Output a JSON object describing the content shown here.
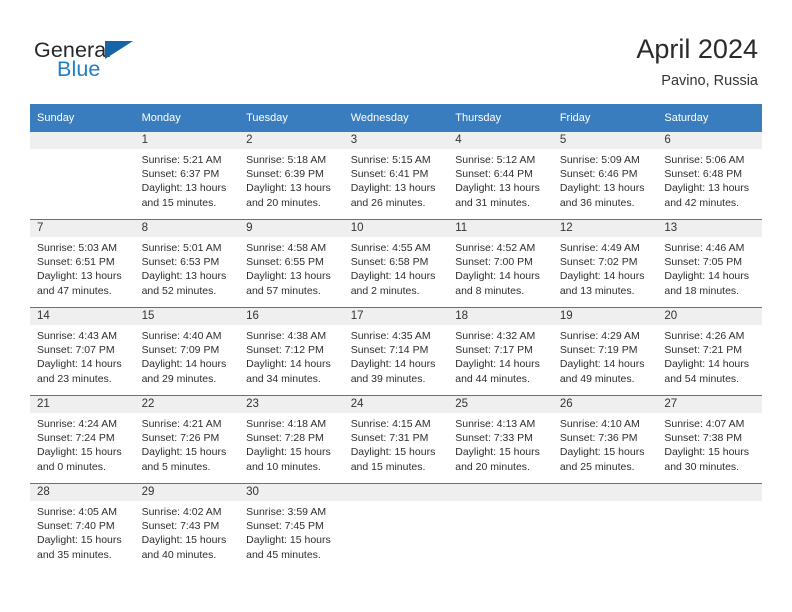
{
  "brand": {
    "name_part1": "General",
    "name_part2": "Blue",
    "triangle_color": "#1565a8",
    "blue_color": "#1f7fc4"
  },
  "header": {
    "title": "April 2024",
    "subtitle": "Pavino, Russia"
  },
  "theme": {
    "header_row_bg": "#3a7dbf",
    "daynum_bg": "#efefef",
    "text_color": "#2e2e2e"
  },
  "weekday_headers": [
    "Sunday",
    "Monday",
    "Tuesday",
    "Wednesday",
    "Thursday",
    "Friday",
    "Saturday"
  ],
  "weeks": [
    [
      {
        "day": "",
        "sunrise": "",
        "sunset": "",
        "daylight": "",
        "empty": true
      },
      {
        "day": "1",
        "sunrise": "Sunrise: 5:21 AM",
        "sunset": "Sunset: 6:37 PM",
        "daylight": "Daylight: 13 hours and 15 minutes."
      },
      {
        "day": "2",
        "sunrise": "Sunrise: 5:18 AM",
        "sunset": "Sunset: 6:39 PM",
        "daylight": "Daylight: 13 hours and 20 minutes."
      },
      {
        "day": "3",
        "sunrise": "Sunrise: 5:15 AM",
        "sunset": "Sunset: 6:41 PM",
        "daylight": "Daylight: 13 hours and 26 minutes."
      },
      {
        "day": "4",
        "sunrise": "Sunrise: 5:12 AM",
        "sunset": "Sunset: 6:44 PM",
        "daylight": "Daylight: 13 hours and 31 minutes."
      },
      {
        "day": "5",
        "sunrise": "Sunrise: 5:09 AM",
        "sunset": "Sunset: 6:46 PM",
        "daylight": "Daylight: 13 hours and 36 minutes."
      },
      {
        "day": "6",
        "sunrise": "Sunrise: 5:06 AM",
        "sunset": "Sunset: 6:48 PM",
        "daylight": "Daylight: 13 hours and 42 minutes."
      }
    ],
    [
      {
        "day": "7",
        "sunrise": "Sunrise: 5:03 AM",
        "sunset": "Sunset: 6:51 PM",
        "daylight": "Daylight: 13 hours and 47 minutes."
      },
      {
        "day": "8",
        "sunrise": "Sunrise: 5:01 AM",
        "sunset": "Sunset: 6:53 PM",
        "daylight": "Daylight: 13 hours and 52 minutes."
      },
      {
        "day": "9",
        "sunrise": "Sunrise: 4:58 AM",
        "sunset": "Sunset: 6:55 PM",
        "daylight": "Daylight: 13 hours and 57 minutes."
      },
      {
        "day": "10",
        "sunrise": "Sunrise: 4:55 AM",
        "sunset": "Sunset: 6:58 PM",
        "daylight": "Daylight: 14 hours and 2 minutes."
      },
      {
        "day": "11",
        "sunrise": "Sunrise: 4:52 AM",
        "sunset": "Sunset: 7:00 PM",
        "daylight": "Daylight: 14 hours and 8 minutes."
      },
      {
        "day": "12",
        "sunrise": "Sunrise: 4:49 AM",
        "sunset": "Sunset: 7:02 PM",
        "daylight": "Daylight: 14 hours and 13 minutes."
      },
      {
        "day": "13",
        "sunrise": "Sunrise: 4:46 AM",
        "sunset": "Sunset: 7:05 PM",
        "daylight": "Daylight: 14 hours and 18 minutes."
      }
    ],
    [
      {
        "day": "14",
        "sunrise": "Sunrise: 4:43 AM",
        "sunset": "Sunset: 7:07 PM",
        "daylight": "Daylight: 14 hours and 23 minutes."
      },
      {
        "day": "15",
        "sunrise": "Sunrise: 4:40 AM",
        "sunset": "Sunset: 7:09 PM",
        "daylight": "Daylight: 14 hours and 29 minutes."
      },
      {
        "day": "16",
        "sunrise": "Sunrise: 4:38 AM",
        "sunset": "Sunset: 7:12 PM",
        "daylight": "Daylight: 14 hours and 34 minutes."
      },
      {
        "day": "17",
        "sunrise": "Sunrise: 4:35 AM",
        "sunset": "Sunset: 7:14 PM",
        "daylight": "Daylight: 14 hours and 39 minutes."
      },
      {
        "day": "18",
        "sunrise": "Sunrise: 4:32 AM",
        "sunset": "Sunset: 7:17 PM",
        "daylight": "Daylight: 14 hours and 44 minutes."
      },
      {
        "day": "19",
        "sunrise": "Sunrise: 4:29 AM",
        "sunset": "Sunset: 7:19 PM",
        "daylight": "Daylight: 14 hours and 49 minutes."
      },
      {
        "day": "20",
        "sunrise": "Sunrise: 4:26 AM",
        "sunset": "Sunset: 7:21 PM",
        "daylight": "Daylight: 14 hours and 54 minutes."
      }
    ],
    [
      {
        "day": "21",
        "sunrise": "Sunrise: 4:24 AM",
        "sunset": "Sunset: 7:24 PM",
        "daylight": "Daylight: 15 hours and 0 minutes."
      },
      {
        "day": "22",
        "sunrise": "Sunrise: 4:21 AM",
        "sunset": "Sunset: 7:26 PM",
        "daylight": "Daylight: 15 hours and 5 minutes."
      },
      {
        "day": "23",
        "sunrise": "Sunrise: 4:18 AM",
        "sunset": "Sunset: 7:28 PM",
        "daylight": "Daylight: 15 hours and 10 minutes."
      },
      {
        "day": "24",
        "sunrise": "Sunrise: 4:15 AM",
        "sunset": "Sunset: 7:31 PM",
        "daylight": "Daylight: 15 hours and 15 minutes."
      },
      {
        "day": "25",
        "sunrise": "Sunrise: 4:13 AM",
        "sunset": "Sunset: 7:33 PM",
        "daylight": "Daylight: 15 hours and 20 minutes."
      },
      {
        "day": "26",
        "sunrise": "Sunrise: 4:10 AM",
        "sunset": "Sunset: 7:36 PM",
        "daylight": "Daylight: 15 hours and 25 minutes."
      },
      {
        "day": "27",
        "sunrise": "Sunrise: 4:07 AM",
        "sunset": "Sunset: 7:38 PM",
        "daylight": "Daylight: 15 hours and 30 minutes."
      }
    ],
    [
      {
        "day": "28",
        "sunrise": "Sunrise: 4:05 AM",
        "sunset": "Sunset: 7:40 PM",
        "daylight": "Daylight: 15 hours and 35 minutes."
      },
      {
        "day": "29",
        "sunrise": "Sunrise: 4:02 AM",
        "sunset": "Sunset: 7:43 PM",
        "daylight": "Daylight: 15 hours and 40 minutes."
      },
      {
        "day": "30",
        "sunrise": "Sunrise: 3:59 AM",
        "sunset": "Sunset: 7:45 PM",
        "daylight": "Daylight: 15 hours and 45 minutes."
      },
      {
        "day": "",
        "sunrise": "",
        "sunset": "",
        "daylight": "",
        "empty": true
      },
      {
        "day": "",
        "sunrise": "",
        "sunset": "",
        "daylight": "",
        "empty": true
      },
      {
        "day": "",
        "sunrise": "",
        "sunset": "",
        "daylight": "",
        "empty": true
      },
      {
        "day": "",
        "sunrise": "",
        "sunset": "",
        "daylight": "",
        "empty": true
      }
    ]
  ]
}
